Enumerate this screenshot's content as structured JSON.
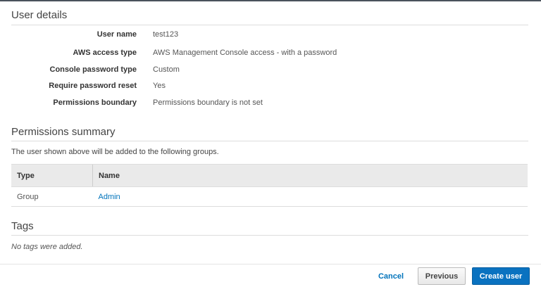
{
  "user_details": {
    "title": "User details",
    "rows": [
      {
        "label": "User name",
        "value": "test123"
      },
      {
        "label": "AWS access type",
        "value": "AWS Management Console access - with a password"
      },
      {
        "label": "Console password type",
        "value": "Custom"
      },
      {
        "label": "Require password reset",
        "value": "Yes"
      },
      {
        "label": "Permissions boundary",
        "value": "Permissions boundary is not set"
      }
    ]
  },
  "permissions": {
    "title": "Permissions summary",
    "description": "The user shown above will be added to the following groups.",
    "columns": [
      "Type",
      "Name"
    ],
    "rows": [
      {
        "type": "Group",
        "name": "Admin"
      }
    ]
  },
  "tags": {
    "title": "Tags",
    "empty": "No tags were added."
  },
  "footer": {
    "cancel": "Cancel",
    "previous": "Previous",
    "create": "Create user"
  },
  "colors": {
    "primary": "#0073bb",
    "link": "#0073bb"
  }
}
